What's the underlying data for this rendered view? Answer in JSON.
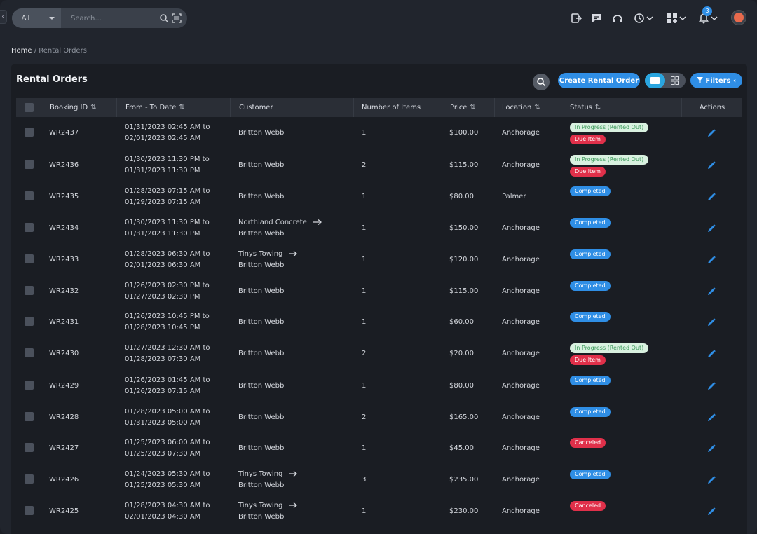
{
  "header": {
    "search_scope": "All",
    "search_placeholder": "Search...",
    "notification_count": "3",
    "icons": [
      "logout-icon",
      "chat-icon",
      "support-icon",
      "history-icon",
      "apps-icon",
      "bell-icon",
      "avatar"
    ]
  },
  "breadcrumb": {
    "home": "Home",
    "separator": "/",
    "current": "Rental Orders"
  },
  "page": {
    "title": "Rental Orders",
    "create_button": "Create Rental Order",
    "filters_button": "Filters"
  },
  "table": {
    "columns": [
      "Booking ID",
      "From - To Date",
      "Customer",
      "Number of Items",
      "Price",
      "Location",
      "Status",
      "Actions"
    ],
    "rows": [
      {
        "id": "WR2437",
        "from": "01/31/2023 02:45 AM to",
        "to": "02/01/2023 02:45 AM",
        "customer": "Britton Webb",
        "sub": "",
        "items": "1",
        "price": "$100.00",
        "location": "Anchorage",
        "status": [
          "In Progress (Rented Out)",
          "Due Item"
        ]
      },
      {
        "id": "WR2436",
        "from": "01/30/2023 11:30 PM to",
        "to": "01/31/2023 11:30 PM",
        "customer": "Britton Webb",
        "sub": "",
        "items": "2",
        "price": "$115.00",
        "location": "Anchorage",
        "status": [
          "In Progress (Rented Out)",
          "Due Item"
        ]
      },
      {
        "id": "WR2435",
        "from": "01/28/2023 07:15 AM to",
        "to": "01/29/2023 07:15 AM",
        "customer": "Britton Webb",
        "sub": "",
        "items": "1",
        "price": "$80.00",
        "location": "Palmer",
        "status": [
          "Completed"
        ]
      },
      {
        "id": "WR2434",
        "from": "01/30/2023 11:30 PM to",
        "to": "01/31/2023 11:30 PM",
        "customer": "Northland Concrete",
        "sub": "Britton Webb",
        "items": "1",
        "price": "$150.00",
        "location": "Anchorage",
        "status": [
          "Completed"
        ]
      },
      {
        "id": "WR2433",
        "from": "01/28/2023 06:30 AM to",
        "to": "02/01/2023 06:30 AM",
        "customer": "Tinys Towing",
        "sub": "Britton Webb",
        "items": "1",
        "price": "$120.00",
        "location": "Anchorage",
        "status": [
          "Completed"
        ]
      },
      {
        "id": "WR2432",
        "from": "01/26/2023 02:30 PM to",
        "to": "01/27/2023 02:30 PM",
        "customer": "Britton Webb",
        "sub": "",
        "items": "1",
        "price": "$115.00",
        "location": "Anchorage",
        "status": [
          "Completed"
        ]
      },
      {
        "id": "WR2431",
        "from": "01/26/2023 10:45 PM to",
        "to": "01/28/2023 10:45 PM",
        "customer": "Britton Webb",
        "sub": "",
        "items": "1",
        "price": "$60.00",
        "location": "Anchorage",
        "status": [
          "Completed"
        ]
      },
      {
        "id": "WR2430",
        "from": "01/27/2023 12:30 AM to",
        "to": "01/28/2023 07:30 AM",
        "customer": "Britton Webb",
        "sub": "",
        "items": "2",
        "price": "$20.00",
        "location": "Anchorage",
        "status": [
          "In Progress (Rented Out)",
          "Due Item"
        ]
      },
      {
        "id": "WR2429",
        "from": "01/26/2023 01:45 AM to",
        "to": "01/26/2023 07:15 AM",
        "customer": "Britton Webb",
        "sub": "",
        "items": "1",
        "price": "$80.00",
        "location": "Anchorage",
        "status": [
          "Completed"
        ]
      },
      {
        "id": "WR2428",
        "from": "01/28/2023 05:00 AM to",
        "to": "01/31/2023 05:00 AM",
        "customer": "Britton Webb",
        "sub": "",
        "items": "2",
        "price": "$165.00",
        "location": "Anchorage",
        "status": [
          "Completed"
        ]
      },
      {
        "id": "WR2427",
        "from": "01/25/2023 06:00 AM to",
        "to": "01/25/2023 07:30 AM",
        "customer": "Britton Webb",
        "sub": "",
        "items": "1",
        "price": "$45.00",
        "location": "Anchorage",
        "status": [
          "Canceled"
        ]
      },
      {
        "id": "WR2426",
        "from": "01/24/2023 05:30 AM to",
        "to": "01/25/2023 05:30 AM",
        "customer": "Tinys Towing",
        "sub": "Britton Webb",
        "items": "3",
        "price": "$235.00",
        "location": "Anchorage",
        "status": [
          "Completed"
        ]
      },
      {
        "id": "WR2425",
        "from": "01/28/2023 04:30 AM to",
        "to": "02/01/2023 04:30 AM",
        "customer": "Tinys Towing",
        "sub": "Britton Webb",
        "items": "1",
        "price": "$230.00",
        "location": "Anchorage",
        "status": [
          "Canceled"
        ]
      }
    ]
  },
  "colors": {
    "accent": "#2f8ee5",
    "progress_bg": "#d9f1e0",
    "progress_text": "#3d9a5b",
    "danger": "#e0304a"
  }
}
